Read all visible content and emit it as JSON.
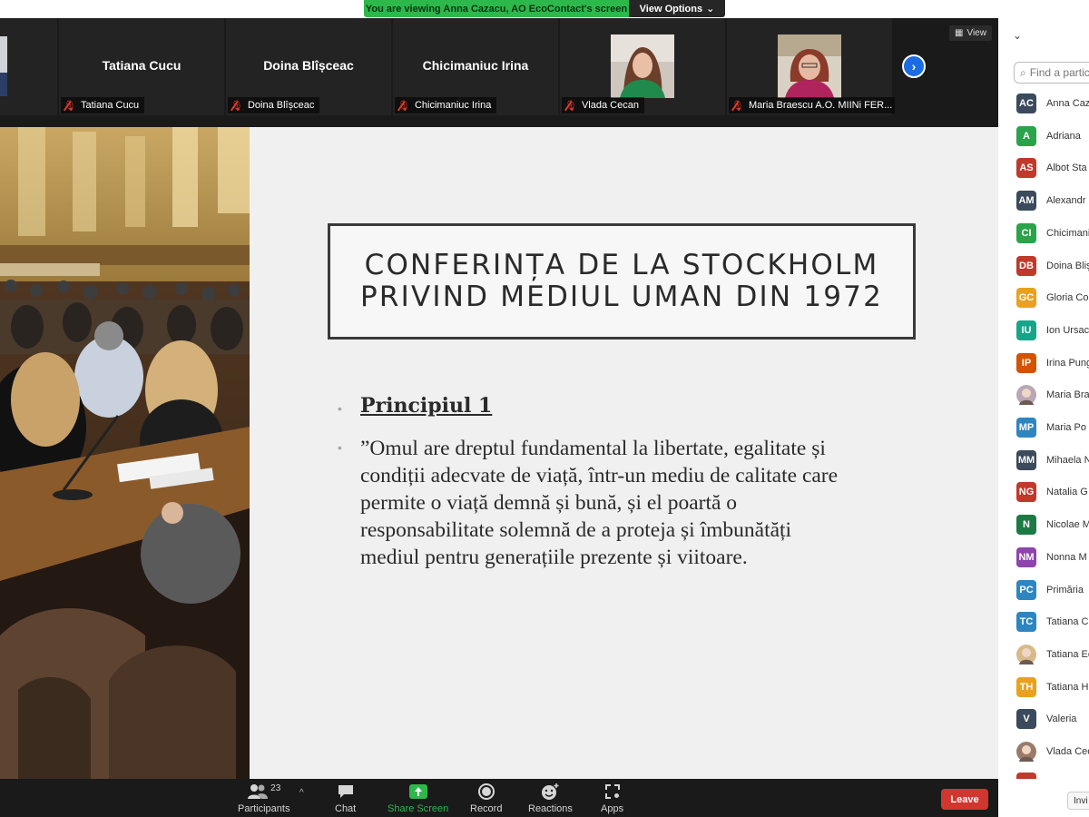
{
  "banner": {
    "message": "You are viewing Anna Cazacu, AO EcoContact's screen",
    "options_label": "View Options",
    "options_icon": "chevron-down-icon",
    "color": "#2db84b"
  },
  "gallery": {
    "view_label": "View",
    "tiles": [
      {
        "big_name": "Tatiana Cucu",
        "tag": "Tatiana Cucu"
      },
      {
        "big_name": "Doina Blîșceac",
        "tag": "Doina Blîșceac"
      },
      {
        "big_name": "Chicimaniuc Irina",
        "tag": "Chicimaniuc Irina"
      },
      {
        "big_name": "",
        "tag": "Vlada Cecan"
      },
      {
        "big_name": "",
        "tag": "Maria Braescu A.O. MIINi FER..."
      }
    ],
    "next_icon": "chevron-right-icon"
  },
  "slide": {
    "title_line1": "CONFERINȚA DE LA STOCKHOLM",
    "title_line2": "PRIVIND MEDIUL UMAN DIN 1972",
    "principle": "Principiul 1",
    "quote_lines": [
      "”Omul are dreptul fundamental la libertate, egalitate și",
      "condiții adecvate de viață, într-un mediu de calitate care",
      "permite o viață demnă și bună, și el poartă o",
      "responsabilitate solemnă de a proteja și îmbunătăți",
      "mediul pentru generațiile prezente și viitoare."
    ]
  },
  "toolbar": {
    "participants_label": "Participants",
    "participants_count": "23",
    "chat_label": "Chat",
    "share_label": "Share Screen",
    "record_label": "Record",
    "reactions_label": "Reactions",
    "apps_label": "Apps",
    "leave_label": "Leave",
    "share_color": "#2db84b",
    "leave_color": "#d0372f"
  },
  "panel": {
    "search_placeholder": "Find a partic",
    "invite_label": "Invi",
    "participants": [
      {
        "initials": "AC",
        "name": "Anna Cazacu",
        "color": "#3b4a5c"
      },
      {
        "initials": "A",
        "name": "Adriana",
        "color": "#2aa34a"
      },
      {
        "initials": "AS",
        "name": "Albot Sta",
        "color": "#c0392b"
      },
      {
        "initials": "AM",
        "name": "Alexandr",
        "color": "#3b4a5c"
      },
      {
        "initials": "CI",
        "name": "Chicimani",
        "color": "#2aa34a"
      },
      {
        "initials": "DB",
        "name": "Doina Bliș",
        "color": "#c0392b"
      },
      {
        "initials": "GC",
        "name": "Gloria Co",
        "color": "#e8a21f"
      },
      {
        "initials": "IU",
        "name": "Ion Ursac",
        "color": "#17a589"
      },
      {
        "initials": "IP",
        "name": "Irina Pung",
        "color": "#d35400"
      },
      {
        "initials": "",
        "name": "Maria Bra",
        "color": "#b9a7b8",
        "photo": true
      },
      {
        "initials": "MP",
        "name": "Maria Po",
        "color": "#2e86c1"
      },
      {
        "initials": "MM",
        "name": "Mihaela N",
        "color": "#3b4a5c"
      },
      {
        "initials": "NG",
        "name": "Natalia G",
        "color": "#c0392b"
      },
      {
        "initials": "N",
        "name": "Nicolae M",
        "color": "#1e7a45"
      },
      {
        "initials": "NM",
        "name": "Nonna M",
        "color": "#8e44ad"
      },
      {
        "initials": "PC",
        "name": "Primăria",
        "color": "#2e86c1"
      },
      {
        "initials": "TC",
        "name": "Tatiana C",
        "color": "#2e86c1"
      },
      {
        "initials": "",
        "name": "Tatiana Ec",
        "color": "#d8b98a",
        "photo": true
      },
      {
        "initials": "TH",
        "name": "Tatiana H",
        "color": "#e8a21f"
      },
      {
        "initials": "V",
        "name": "Valeria",
        "color": "#3b4a5c"
      },
      {
        "initials": "",
        "name": "Vlada Cec",
        "color": "#9a7b6a",
        "photo": true
      }
    ]
  }
}
